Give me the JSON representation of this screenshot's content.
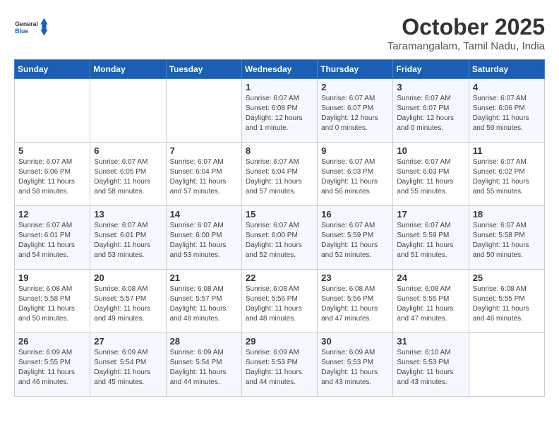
{
  "logo": {
    "general": "General",
    "blue": "Blue"
  },
  "title": "October 2025",
  "location": "Taramangalam, Tamil Nadu, India",
  "days_of_week": [
    "Sunday",
    "Monday",
    "Tuesday",
    "Wednesday",
    "Thursday",
    "Friday",
    "Saturday"
  ],
  "weeks": [
    [
      {
        "day": "",
        "info": ""
      },
      {
        "day": "",
        "info": ""
      },
      {
        "day": "",
        "info": ""
      },
      {
        "day": "1",
        "info": "Sunrise: 6:07 AM\nSunset: 6:08 PM\nDaylight: 12 hours\nand 1 minute."
      },
      {
        "day": "2",
        "info": "Sunrise: 6:07 AM\nSunset: 6:07 PM\nDaylight: 12 hours\nand 0 minutes."
      },
      {
        "day": "3",
        "info": "Sunrise: 6:07 AM\nSunset: 6:07 PM\nDaylight: 12 hours\nand 0 minutes."
      },
      {
        "day": "4",
        "info": "Sunrise: 6:07 AM\nSunset: 6:06 PM\nDaylight: 11 hours\nand 59 minutes."
      }
    ],
    [
      {
        "day": "5",
        "info": "Sunrise: 6:07 AM\nSunset: 6:06 PM\nDaylight: 11 hours\nand 58 minutes."
      },
      {
        "day": "6",
        "info": "Sunrise: 6:07 AM\nSunset: 6:05 PM\nDaylight: 11 hours\nand 58 minutes."
      },
      {
        "day": "7",
        "info": "Sunrise: 6:07 AM\nSunset: 6:04 PM\nDaylight: 11 hours\nand 57 minutes."
      },
      {
        "day": "8",
        "info": "Sunrise: 6:07 AM\nSunset: 6:04 PM\nDaylight: 11 hours\nand 57 minutes."
      },
      {
        "day": "9",
        "info": "Sunrise: 6:07 AM\nSunset: 6:03 PM\nDaylight: 11 hours\nand 56 minutes."
      },
      {
        "day": "10",
        "info": "Sunrise: 6:07 AM\nSunset: 6:03 PM\nDaylight: 11 hours\nand 55 minutes."
      },
      {
        "day": "11",
        "info": "Sunrise: 6:07 AM\nSunset: 6:02 PM\nDaylight: 11 hours\nand 55 minutes."
      }
    ],
    [
      {
        "day": "12",
        "info": "Sunrise: 6:07 AM\nSunset: 6:01 PM\nDaylight: 11 hours\nand 54 minutes."
      },
      {
        "day": "13",
        "info": "Sunrise: 6:07 AM\nSunset: 6:01 PM\nDaylight: 11 hours\nand 53 minutes."
      },
      {
        "day": "14",
        "info": "Sunrise: 6:07 AM\nSunset: 6:00 PM\nDaylight: 11 hours\nand 53 minutes."
      },
      {
        "day": "15",
        "info": "Sunrise: 6:07 AM\nSunset: 6:00 PM\nDaylight: 11 hours\nand 52 minutes."
      },
      {
        "day": "16",
        "info": "Sunrise: 6:07 AM\nSunset: 5:59 PM\nDaylight: 11 hours\nand 52 minutes."
      },
      {
        "day": "17",
        "info": "Sunrise: 6:07 AM\nSunset: 5:59 PM\nDaylight: 11 hours\nand 51 minutes."
      },
      {
        "day": "18",
        "info": "Sunrise: 6:07 AM\nSunset: 5:58 PM\nDaylight: 11 hours\nand 50 minutes."
      }
    ],
    [
      {
        "day": "19",
        "info": "Sunrise: 6:08 AM\nSunset: 5:58 PM\nDaylight: 11 hours\nand 50 minutes."
      },
      {
        "day": "20",
        "info": "Sunrise: 6:08 AM\nSunset: 5:57 PM\nDaylight: 11 hours\nand 49 minutes."
      },
      {
        "day": "21",
        "info": "Sunrise: 6:08 AM\nSunset: 5:57 PM\nDaylight: 11 hours\nand 48 minutes."
      },
      {
        "day": "22",
        "info": "Sunrise: 6:08 AM\nSunset: 5:56 PM\nDaylight: 11 hours\nand 48 minutes."
      },
      {
        "day": "23",
        "info": "Sunrise: 6:08 AM\nSunset: 5:56 PM\nDaylight: 11 hours\nand 47 minutes."
      },
      {
        "day": "24",
        "info": "Sunrise: 6:08 AM\nSunset: 5:55 PM\nDaylight: 11 hours\nand 47 minutes."
      },
      {
        "day": "25",
        "info": "Sunrise: 6:08 AM\nSunset: 5:55 PM\nDaylight: 11 hours\nand 46 minutes."
      }
    ],
    [
      {
        "day": "26",
        "info": "Sunrise: 6:09 AM\nSunset: 5:55 PM\nDaylight: 11 hours\nand 46 minutes."
      },
      {
        "day": "27",
        "info": "Sunrise: 6:09 AM\nSunset: 5:54 PM\nDaylight: 11 hours\nand 45 minutes."
      },
      {
        "day": "28",
        "info": "Sunrise: 6:09 AM\nSunset: 5:54 PM\nDaylight: 11 hours\nand 44 minutes."
      },
      {
        "day": "29",
        "info": "Sunrise: 6:09 AM\nSunset: 5:53 PM\nDaylight: 11 hours\nand 44 minutes."
      },
      {
        "day": "30",
        "info": "Sunrise: 6:09 AM\nSunset: 5:53 PM\nDaylight: 11 hours\nand 43 minutes."
      },
      {
        "day": "31",
        "info": "Sunrise: 6:10 AM\nSunset: 5:53 PM\nDaylight: 11 hours\nand 43 minutes."
      },
      {
        "day": "",
        "info": ""
      }
    ]
  ]
}
